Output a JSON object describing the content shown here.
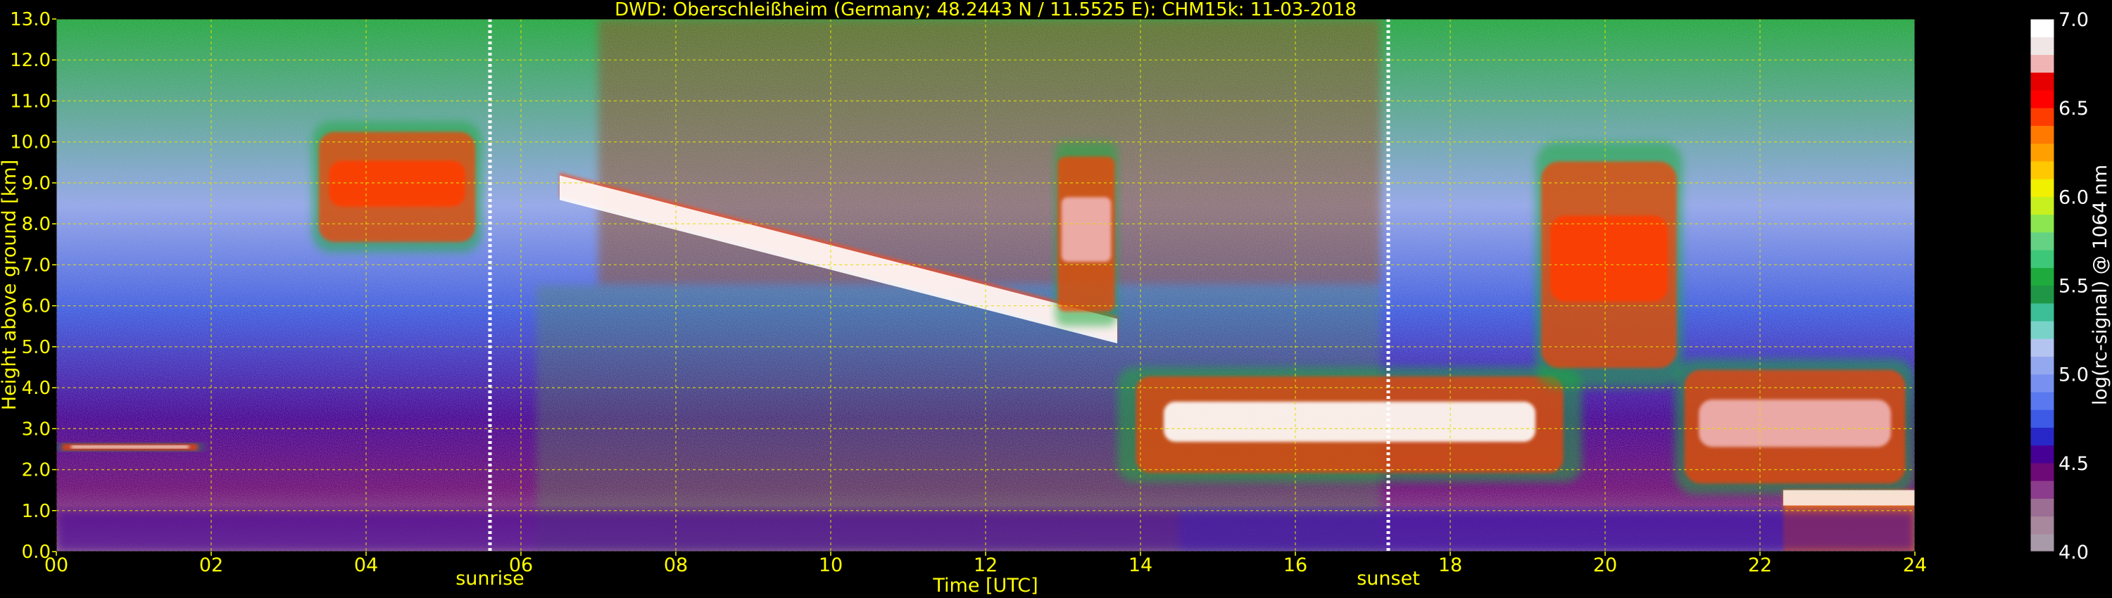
{
  "chart_data": {
    "type": "heatmap",
    "title": "DWD: Oberschleißheim (Germany; 48.2443 N / 11.5525 E):    CHM15k: 11-03-2018",
    "xlabel": "Time [UTC]",
    "ylabel": "Height above ground [km]",
    "xlim": [
      0,
      24
    ],
    "ylim": [
      0,
      13
    ],
    "x_ticks": [
      "00",
      "02",
      "04",
      "06",
      "08",
      "10",
      "12",
      "14",
      "16",
      "18",
      "20",
      "22",
      "24"
    ],
    "x_tick_values": [
      0,
      2,
      4,
      6,
      8,
      10,
      12,
      14,
      16,
      18,
      20,
      22,
      24
    ],
    "y_ticks": [
      "0.0",
      "1.0",
      "2.0",
      "3.0",
      "4.0",
      "5.0",
      "6.0",
      "7.0",
      "8.0",
      "9.0",
      "10.0",
      "11.0",
      "12.0",
      "13.0"
    ],
    "y_tick_values": [
      0,
      1,
      2,
      3,
      4,
      5,
      6,
      7,
      8,
      9,
      10,
      11,
      12,
      13
    ],
    "grid": true,
    "colorbar": {
      "label": "log(rc-signal) @ 1064 nm",
      "range": [
        4.0,
        7.0
      ],
      "ticks": [
        "4.0",
        "4.5",
        "5.0",
        "5.5",
        "6.0",
        "6.5",
        "7.0"
      ],
      "tick_values": [
        4.0,
        4.5,
        5.0,
        5.5,
        6.0,
        6.5,
        7.0
      ],
      "colors": [
        "#a89aa8",
        "#a8889c",
        "#9c6e94",
        "#8c3c8c",
        "#6e0a78",
        "#460096",
        "#2828c8",
        "#3c5ae6",
        "#5a78f0",
        "#7890f0",
        "#94a8f0",
        "#b4c4f0",
        "#78d2c8",
        "#3cbe96",
        "#1e9646",
        "#1eaa3c",
        "#3cc878",
        "#64d282",
        "#8ce650",
        "#c8f01e",
        "#f0f000",
        "#ffc800",
        "#ffa000",
        "#ff7800",
        "#ff3c00",
        "#ff0000",
        "#e60000",
        "#f0b4b4",
        "#f0e6e6",
        "#ffffff"
      ]
    },
    "annotations": [
      {
        "text": "sunrise",
        "x": 5.6
      },
      {
        "text": "sunset",
        "x": 17.2
      }
    ],
    "features": [
      {
        "kind": "cloud_layer",
        "x": [
          0.0,
          1.9
        ],
        "y": [
          2.45,
          2.65
        ],
        "intensity": 6.9
      },
      {
        "kind": "cirrus",
        "x": [
          3.3,
          5.5
        ],
        "y": [
          7.3,
          10.5
        ],
        "intensity": 6.4
      },
      {
        "kind": "cirrus_band",
        "x": [
          6.5,
          13.7
        ],
        "y_start": 9.0,
        "y_end": 5.5,
        "intensity": 6.9
      },
      {
        "kind": "cirrus",
        "x": [
          12.9,
          13.7
        ],
        "y": [
          5.5,
          10.0
        ],
        "intensity": 6.7
      },
      {
        "kind": "cloud_layer",
        "x": [
          13.7,
          19.7
        ],
        "y": [
          1.7,
          4.5
        ],
        "intensity": 6.9
      },
      {
        "kind": "cirrus",
        "x": [
          19.1,
          21.0
        ],
        "y": [
          4.0,
          10.0
        ],
        "intensity": 6.4
      },
      {
        "kind": "cloud_layer",
        "x": [
          20.9,
          24.0
        ],
        "y": [
          1.4,
          4.7
        ],
        "intensity": 6.8
      },
      {
        "kind": "precipitation",
        "x": [
          22.3,
          24.0
        ],
        "y": [
          0.0,
          1.5
        ],
        "intensity": 6.3
      },
      {
        "kind": "boundary_layer",
        "x": [
          0.0,
          24.0
        ],
        "y": [
          0.0,
          1.0
        ],
        "intensity": 4.5
      }
    ]
  }
}
